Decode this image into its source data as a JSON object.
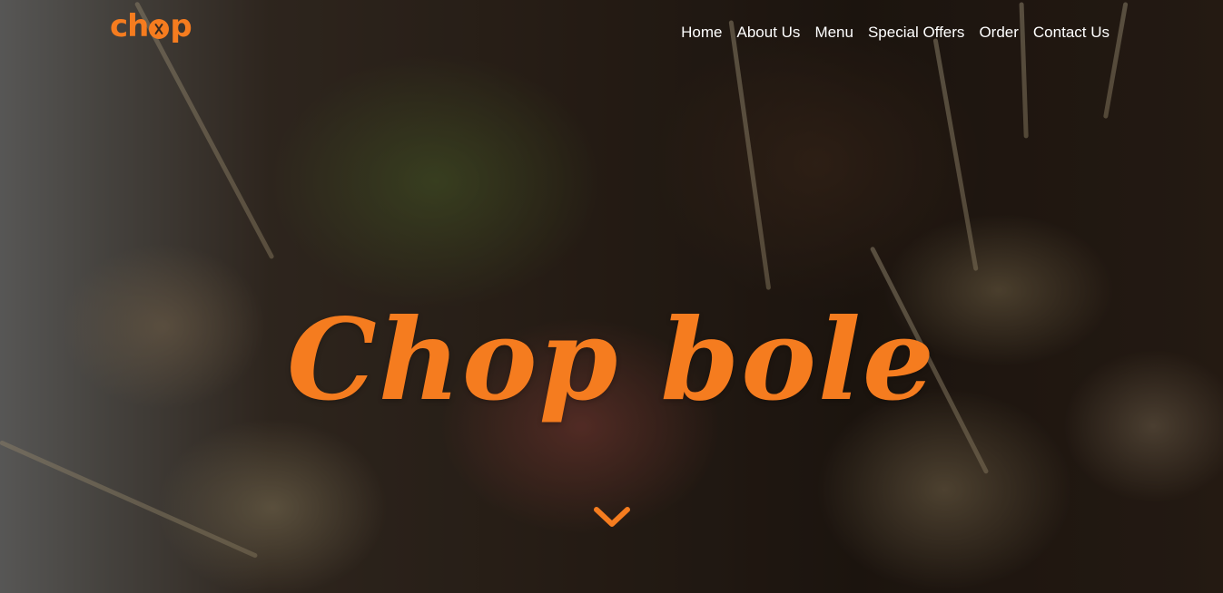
{
  "brand": {
    "logo_text_left": "ch",
    "logo_text_right": "p",
    "accent_color": "#f57c1f"
  },
  "nav": {
    "items": [
      {
        "label": "Home"
      },
      {
        "label": "About Us"
      },
      {
        "label": "Menu"
      },
      {
        "label": "Special Offers"
      },
      {
        "label": "Order"
      },
      {
        "label": "Contact Us"
      }
    ]
  },
  "hero": {
    "title": "Chop bole",
    "background_description_icon": "food-photo-background",
    "scroll_icon": "chevron-down-icon"
  }
}
